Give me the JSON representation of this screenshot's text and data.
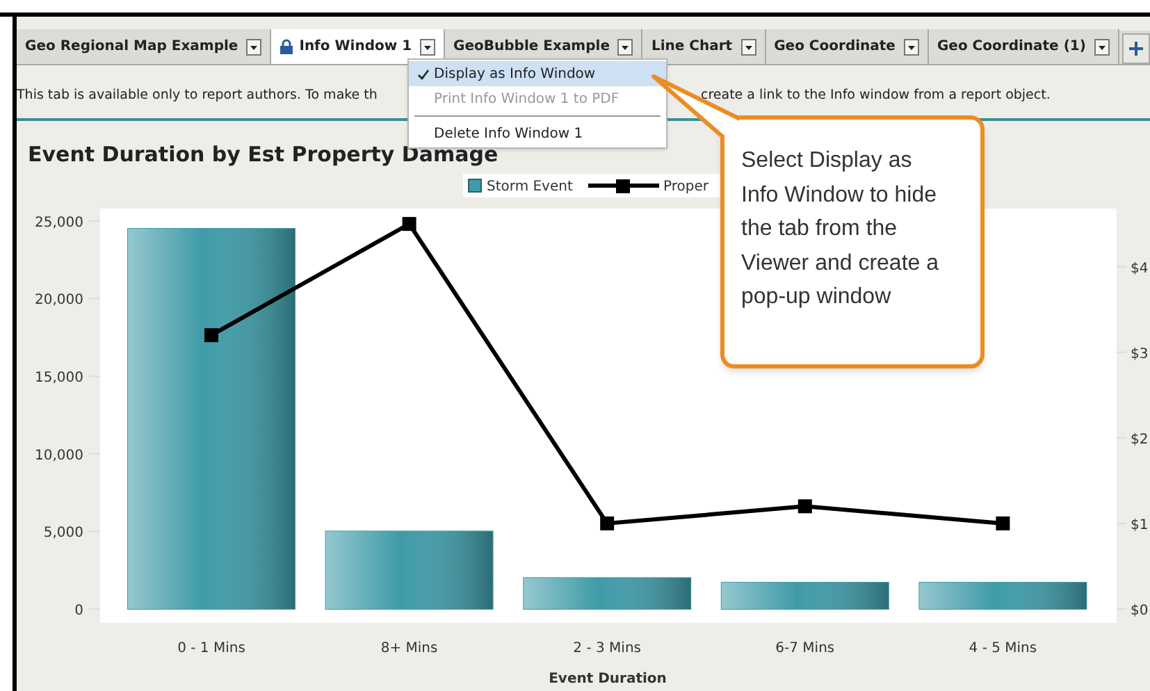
{
  "tabs": [
    {
      "label": "Geo Regional Map Example",
      "selected": false,
      "locked": false
    },
    {
      "label": "Info Window 1",
      "selected": true,
      "locked": true
    },
    {
      "label": "GeoBubble Example",
      "selected": false,
      "locked": false
    },
    {
      "label": "Line Chart",
      "selected": false,
      "locked": false
    },
    {
      "label": "Geo Coordinate",
      "selected": false,
      "locked": false
    },
    {
      "label": "Geo Coordinate (1)",
      "selected": false,
      "locked": false
    }
  ],
  "tab_menu": {
    "items": [
      {
        "kind": "item",
        "label": "Display as Info Window",
        "checked": true,
        "selected": true,
        "disabled": false
      },
      {
        "kind": "item",
        "label": "Print Info Window 1 to PDF",
        "checked": false,
        "selected": false,
        "disabled": true
      },
      {
        "kind": "divider"
      },
      {
        "kind": "item",
        "label": "Delete Info Window 1",
        "checked": false,
        "selected": false,
        "disabled": false
      }
    ]
  },
  "info_text": [
    "This tab is available only to report authors.  To make th",
    "create a link to the Info window from a report object."
  ],
  "panel": {
    "title": "Event Duration by Est Property Damage",
    "chart_data": {
      "type": "bar",
      "xlabel": "Event Duration",
      "categories": [
        "0 - 1 Mins",
        "8+ Mins",
        "2 - 3 Mins",
        "6-7 Mins",
        "4 - 5 Mins"
      ],
      "series": [
        {
          "name": "Storm Event",
          "color": "#3f9ba8",
          "values": [
            24500,
            5000,
            2000,
            1700,
            1700
          ]
        },
        {
          "name": "Proper",
          "type": "line",
          "marker": "square",
          "color": "#000000",
          "axis": "y2",
          "values": [
            3.2,
            4.5,
            1.0,
            1.2,
            1.0
          ]
        }
      ],
      "legend": "top",
      "ylim": [
        0,
        25800
      ],
      "y2lim": [
        0,
        4.68
      ],
      "yticks": [
        {
          "value": 0,
          "label": "0"
        },
        {
          "value": 5000,
          "label": "5,000"
        },
        {
          "value": 10000,
          "label": "10,000"
        },
        {
          "value": 15000,
          "label": "15,000"
        },
        {
          "value": 20000,
          "label": "20,000"
        },
        {
          "value": 25000,
          "label": "25,000"
        }
      ],
      "y2ticks": [
        {
          "value": 0,
          "label": "$0"
        },
        {
          "value": 1,
          "label": "$1"
        },
        {
          "value": 2,
          "label": "$2"
        },
        {
          "value": 3,
          "label": "$3"
        },
        {
          "value": 4,
          "label": "$4"
        }
      ]
    }
  },
  "callout": {
    "text": "Select Display as Info Window to hide the tab from the Viewer and create a pop-up window"
  }
}
